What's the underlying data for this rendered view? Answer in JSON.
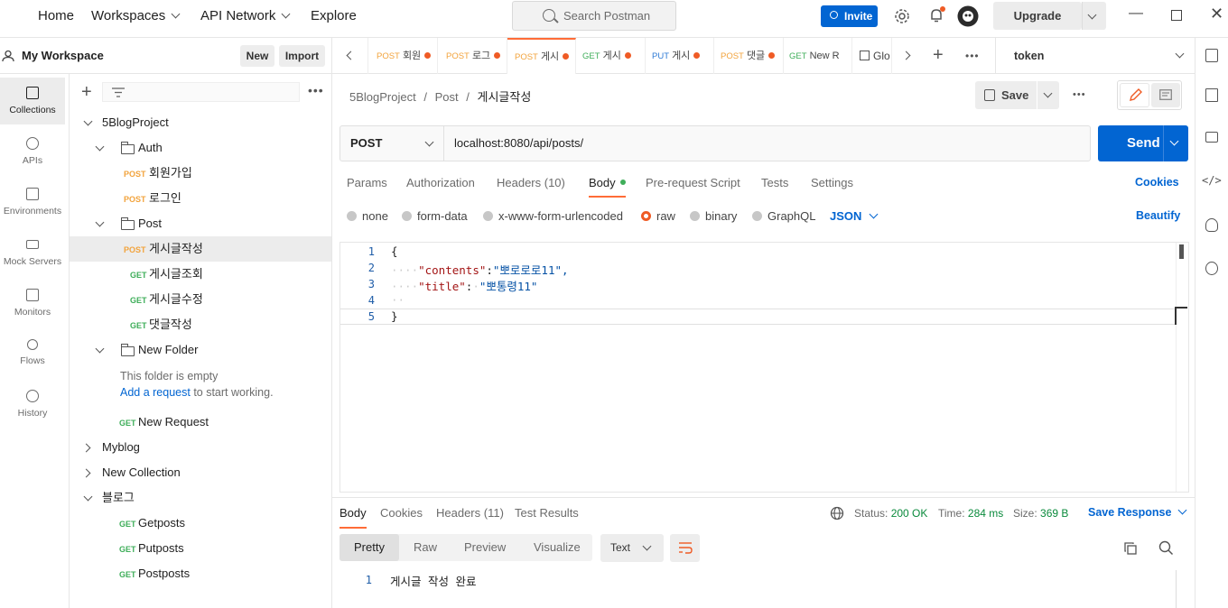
{
  "topnav": {
    "home": "Home",
    "workspaces": "Workspaces",
    "api_network": "API Network",
    "explore": "Explore",
    "search_placeholder": "Search Postman",
    "invite": "Invite",
    "upgrade": "Upgrade"
  },
  "workspace": {
    "title": "My Workspace",
    "new_label": "New",
    "import_label": "Import"
  },
  "rail": [
    {
      "label": "Collections",
      "icon": "collections-icon"
    },
    {
      "label": "APIs",
      "icon": "apis-icon"
    },
    {
      "label": "Environments",
      "icon": "environments-icon"
    },
    {
      "label": "Mock Servers",
      "icon": "mock-servers-icon"
    },
    {
      "label": "Monitors",
      "icon": "monitors-icon"
    },
    {
      "label": "Flows",
      "icon": "flows-icon"
    },
    {
      "label": "History",
      "icon": "history-icon"
    }
  ],
  "tree": {
    "collection": "5BlogProject",
    "auth_folder": "Auth",
    "auth_items": [
      {
        "method": "POST",
        "name": "회원가입"
      },
      {
        "method": "POST",
        "name": "로그인"
      }
    ],
    "post_folder": "Post",
    "post_items": [
      {
        "method": "POST",
        "name": "게시글작성"
      },
      {
        "method": "GET",
        "name": "게시글조회"
      },
      {
        "method": "GET",
        "name": "게시글수정"
      },
      {
        "method": "GET",
        "name": "댓글작성"
      }
    ],
    "new_folder": "New Folder",
    "empty_text": "This folder is empty",
    "add_request_link": "Add a request",
    "add_request_suffix": " to start working.",
    "new_request": {
      "method": "GET",
      "name": "New Request"
    },
    "myblog": "Myblog",
    "new_collection": "New Collection",
    "blog_collection": "블로그",
    "blog_items": [
      {
        "method": "GET",
        "name": "Getposts"
      },
      {
        "method": "GET",
        "name": "Putposts"
      },
      {
        "method": "GET",
        "name": "Postposts"
      }
    ]
  },
  "tabs": [
    {
      "method": "POST",
      "name": "회원"
    },
    {
      "method": "POST",
      "name": "로그"
    },
    {
      "method": "POST",
      "name": "게시"
    },
    {
      "method": "GET",
      "name": "게시"
    },
    {
      "method": "PUT",
      "name": "게시"
    },
    {
      "method": "POST",
      "name": "댓글"
    },
    {
      "method": "GET",
      "name": "New R"
    },
    {
      "method": "",
      "name": "Glo"
    }
  ],
  "environment": "token",
  "breadcrumb": {
    "collection": "5BlogProject",
    "folder": "Post",
    "request": "게시글작성",
    "sep": "/"
  },
  "save_label": "Save",
  "request": {
    "method": "POST",
    "url": "localhost:8080/api/posts/",
    "send_label": "Send"
  },
  "request_tabs": {
    "params": "Params",
    "authorization": "Authorization",
    "headers": "Headers (10)",
    "body": "Body",
    "prerequest": "Pre-request Script",
    "tests": "Tests",
    "settings": "Settings",
    "cookies": "Cookies"
  },
  "body_modes": {
    "none": "none",
    "form_data": "form-data",
    "urlencoded": "x-www-form-urlencoded",
    "raw": "raw",
    "binary": "binary",
    "graphql": "GraphQL",
    "json": "JSON",
    "beautify": "Beautify"
  },
  "editor_lines": [
    {
      "n": "1",
      "text": "{"
    },
    {
      "n": "2",
      "key": "\"contents\"",
      "val": "\"뽀로로로11\","
    },
    {
      "n": "3",
      "key": "\"title\"",
      "val": "\"뽀통령11\""
    },
    {
      "n": "4",
      "text": ""
    },
    {
      "n": "5",
      "text": "}"
    }
  ],
  "response": {
    "tabs": {
      "body": "Body",
      "cookies": "Cookies",
      "headers": "Headers (11)",
      "test_results": "Test Results"
    },
    "status_label": "Status:",
    "status_value": "200 OK",
    "time_label": "Time:",
    "time_value": "284 ms",
    "size_label": "Size:",
    "size_value": "369 B",
    "save_response": "Save Response",
    "views": {
      "pretty": "Pretty",
      "raw": "Raw",
      "preview": "Preview",
      "visualize": "Visualize"
    },
    "format": "Text",
    "line_no": "1",
    "body_text": "게시글 작성 완료"
  },
  "colors": {
    "accent": "#ff6c37",
    "primary": "#0265d2",
    "post": "#f2a33c",
    "get": "#3fae5a",
    "put": "#2f7bd6",
    "status_ok": "#0a8a3c"
  }
}
